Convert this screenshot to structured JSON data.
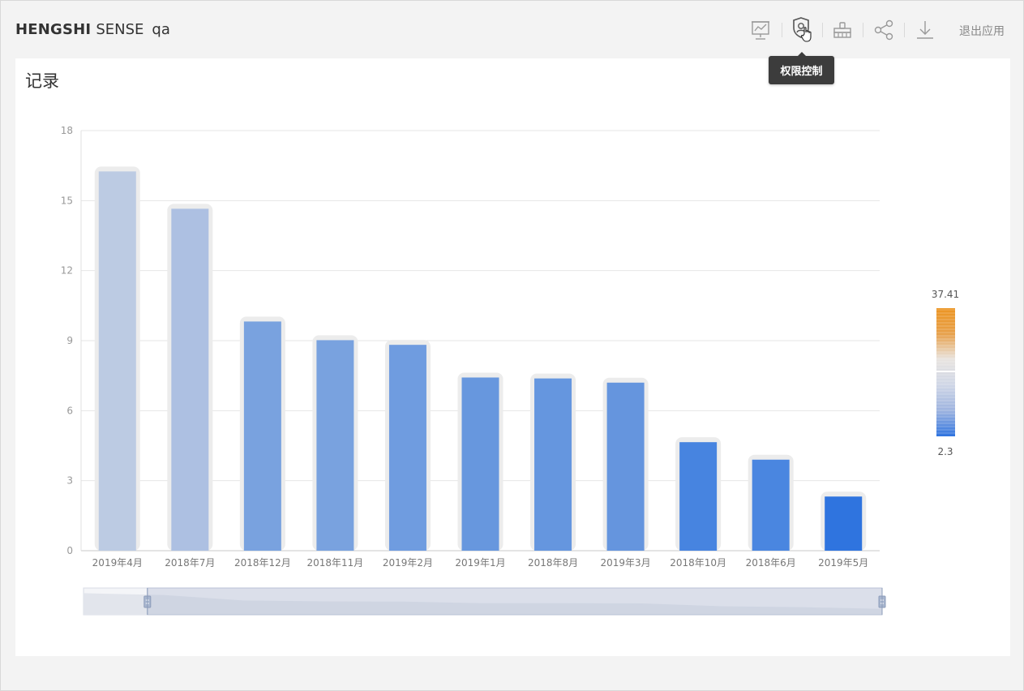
{
  "header": {
    "brand_main": "HENGSHI",
    "brand_sub": "SENSE",
    "app_name": "qa",
    "exit_label": "退出应用",
    "tooltip": "权限控制"
  },
  "toolbar": {
    "icons": [
      "presentation-icon",
      "permission-shield-icon",
      "clean-brush-icon",
      "share-icon",
      "download-icon"
    ]
  },
  "card": {
    "title": "记录"
  },
  "chart_data": {
    "type": "bar",
    "title": "记录",
    "categories": [
      "2019年4月",
      "2018年7月",
      "2018年12月",
      "2018年11月",
      "2019年2月",
      "2019年1月",
      "2018年8月",
      "2019年3月",
      "2018年10月",
      "2018年6月",
      "2019年5月"
    ],
    "values": [
      16.25,
      14.65,
      9.82,
      9.02,
      8.82,
      7.42,
      7.38,
      7.2,
      4.65,
      3.9,
      2.32
    ],
    "ylim": [
      0,
      18
    ],
    "yticks": [
      0,
      3,
      6,
      9,
      12,
      15,
      18
    ],
    "grid": true,
    "color_scale": {
      "max_label": "37.41",
      "min_label": "2.3",
      "min": 2.3,
      "max": 37.41,
      "colors": [
        "#2f74df",
        "#9db3df",
        "#cfd6e6",
        "#e8e4e0",
        "#e7a04a",
        "#ec9523"
      ]
    },
    "bar_colors": [
      "#bccbe3",
      "#adc0e2",
      "#79a2df",
      "#79a2df",
      "#6f9ce0",
      "#6797de",
      "#6596df",
      "#6595de",
      "#4784e0",
      "#4a86e0",
      "#2f74df"
    ],
    "data_zoom": {
      "start": 0.08,
      "end": 1.0
    }
  }
}
